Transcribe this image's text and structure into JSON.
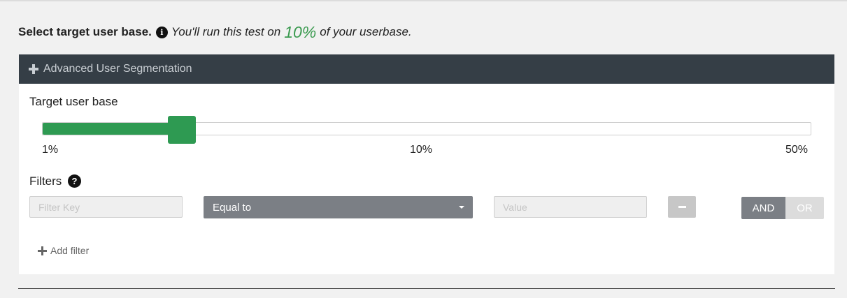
{
  "heading": {
    "title": "Select target user base.",
    "note_prefix": "You'll run this test on",
    "percent": "10%",
    "note_suffix": "of your userbase."
  },
  "segmentation": {
    "header_label": "Advanced User Segmentation"
  },
  "slider": {
    "label": "Target user base",
    "value_fraction": 0.1818,
    "ticks": [
      "1%",
      "10%",
      "50%"
    ]
  },
  "filters": {
    "label": "Filters",
    "key_placeholder": "Filter Key",
    "operator_selected": "Equal to",
    "value_placeholder": "Value",
    "and_label": "AND",
    "or_label": "OR",
    "add_label": "Add filter"
  },
  "colors": {
    "accent": "#2e9a52",
    "header_bg": "#353e46"
  }
}
